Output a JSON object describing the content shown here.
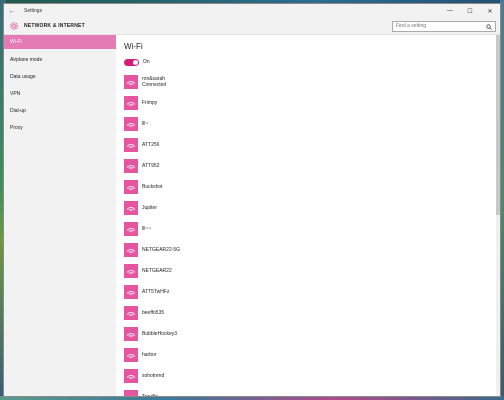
{
  "window": {
    "title": "Settings",
    "back_icon": "back-arrow-icon",
    "minimize": "—",
    "maximize": "☐",
    "close": "✕"
  },
  "header": {
    "title": "NETWORK & INTERNET",
    "search_placeholder": "Find a setting"
  },
  "sidebar": {
    "items": [
      {
        "label": "Wi-Fi",
        "active": true
      },
      {
        "label": "Airplane mode"
      },
      {
        "label": "Data usage"
      },
      {
        "label": "VPN"
      },
      {
        "label": "Dial-up"
      },
      {
        "label": "Proxy"
      }
    ]
  },
  "main": {
    "title": "Wi-Fi",
    "toggle_label": "On",
    "networks": [
      {
        "name": "ron&sarah",
        "status": "Connected"
      },
      {
        "name": "Frimpy"
      },
      {
        "name": "lll~"
      },
      {
        "name": "ATT256"
      },
      {
        "name": "ATT952"
      },
      {
        "name": "Buckshot"
      },
      {
        "name": "Jupiter"
      },
      {
        "name": "lll~~"
      },
      {
        "name": "NETGEAR22-5G"
      },
      {
        "name": "NETGEAR22"
      },
      {
        "name": "ATT5TwHFz"
      },
      {
        "name": "beeffo535"
      },
      {
        "name": "BubbleHockey3"
      },
      {
        "name": "harbor"
      },
      {
        "name": "sohotrend"
      },
      {
        "name": "Treville"
      }
    ]
  },
  "colors": {
    "accent": "#e6559f",
    "active_nav": "#e57bb4",
    "toggle_on": "#d81b78"
  }
}
